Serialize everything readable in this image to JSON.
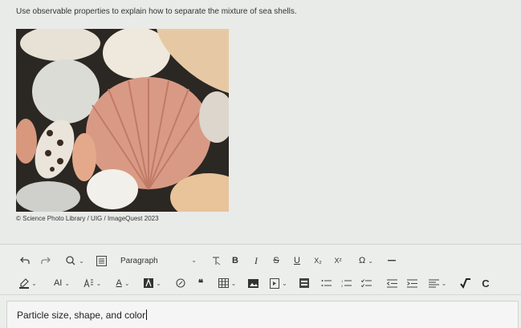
{
  "question": {
    "text": "Use observable properties to explain how to separate the mixture of sea shells."
  },
  "image": {
    "credit": "© Science Photo Library / UIG / ImageQuest 2023"
  },
  "toolbar": {
    "paragraph_label": "Paragraph",
    "bold_label": "B",
    "italic_label": "I",
    "strike_label": "S",
    "underline_label": "U",
    "subscript_label": "X₂",
    "superscript_label": "X²",
    "omega_label": "Ω",
    "font_family_label": "AI",
    "font_size_label": "A",
    "quote_label": "❝",
    "c_label": "C"
  },
  "answer": {
    "text": "Particle size, shape, and color"
  }
}
